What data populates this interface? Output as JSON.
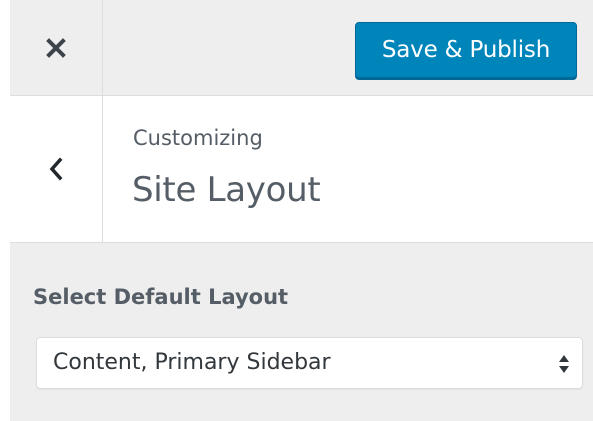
{
  "header": {
    "close_icon": "close-icon",
    "save_publish_label": "Save & Publish",
    "accent_color": "#0085ba"
  },
  "section": {
    "back_icon": "chevron-left-icon",
    "breadcrumb": "Customizing",
    "title": "Site Layout"
  },
  "control": {
    "label": "Select Default Layout",
    "selected_value": "Content, Primary Sidebar",
    "arrows_icon": "select-arrows-icon"
  }
}
